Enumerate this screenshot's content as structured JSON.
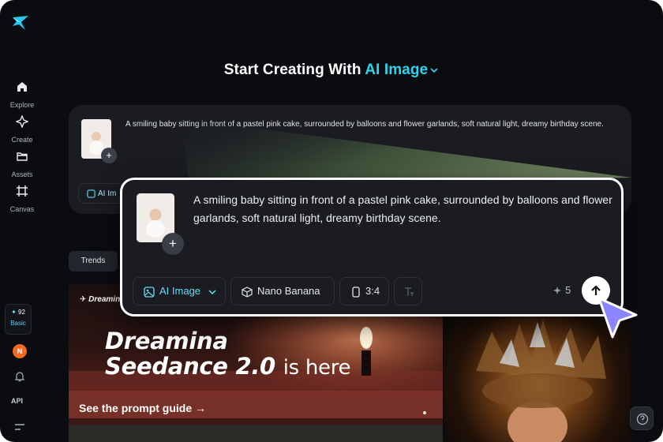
{
  "sidebar": {
    "items": [
      {
        "label": "Explore",
        "icon": "home-icon"
      },
      {
        "label": "Create",
        "icon": "sparkle-icon"
      },
      {
        "label": "Assets",
        "icon": "folder-icon"
      },
      {
        "label": "Canvas",
        "icon": "canvas-icon"
      }
    ],
    "credits": "92",
    "plan": "Basic",
    "avatar_initial": "N",
    "api_label": "API"
  },
  "headline": {
    "prefix": "Start Creating With",
    "mode": "AI Image"
  },
  "prompt": {
    "text": "A smiling baby sitting in front of a pastel pink cake, surrounded by balloons and flower garlands, soft natural light, dreamy birthday scene.",
    "mode_chip": "AI Image",
    "mode_chip_short": "AI Im",
    "model_chip": "Nano Banana",
    "ratio_chip": "3:4",
    "credit_cost": "5",
    "add_symbol": "+"
  },
  "feed": {
    "tab": "Trends",
    "banner_brand": "Dreamina",
    "banner_title_line1": "Dreamina",
    "banner_title_line2": "Seedance 2.0",
    "banner_title_suffix": "is here",
    "banner_cta": "See the prompt guide →"
  },
  "colors": {
    "accent": "#2fd3f0",
    "background": "#0b0c10",
    "card": "#1a1c22",
    "cursor": "#8b86ff"
  }
}
